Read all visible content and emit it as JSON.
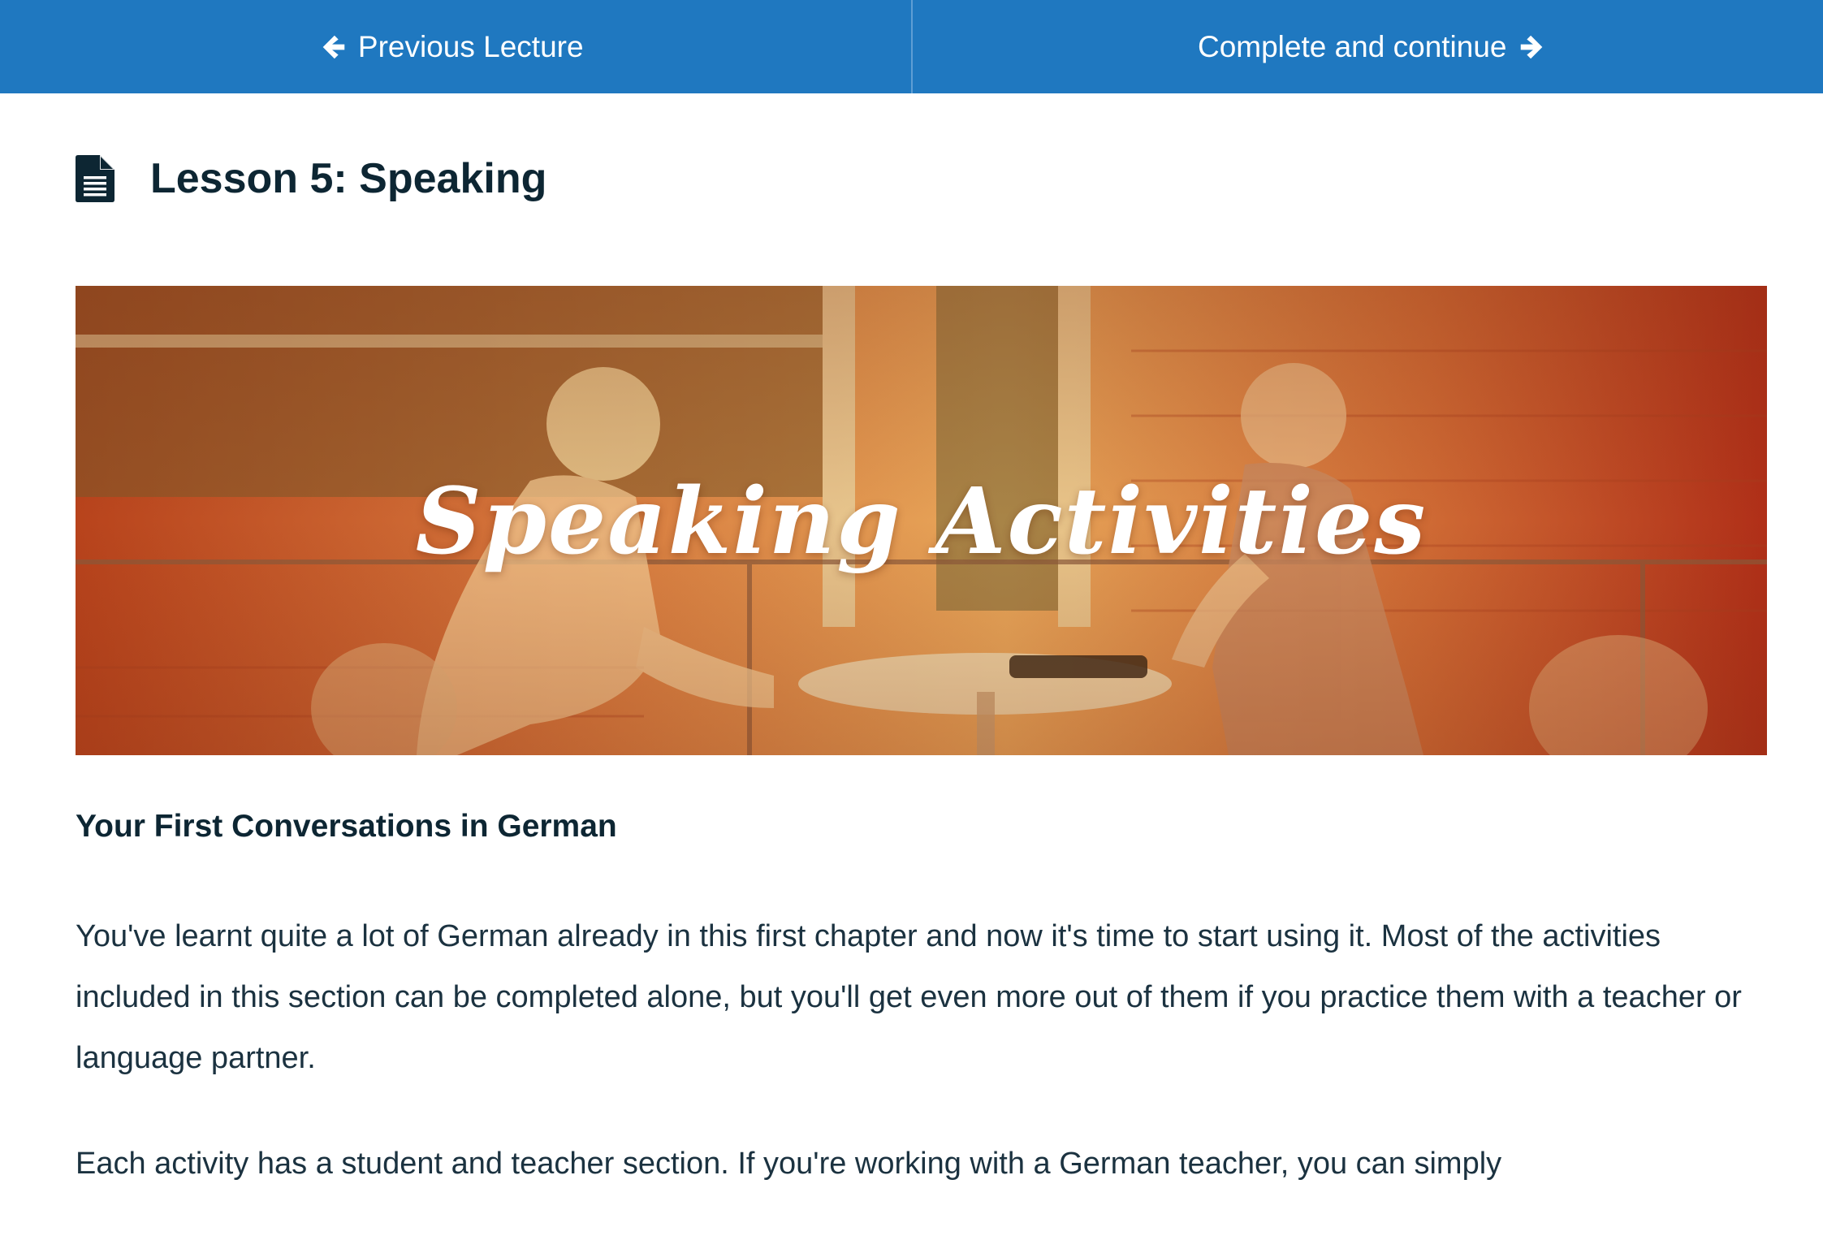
{
  "nav": {
    "previous_label": "Previous Lecture",
    "next_label": "Complete and continue",
    "accent_color": "#1f78c0"
  },
  "lesson": {
    "title": "Lesson 5: Speaking",
    "icon": "document-icon"
  },
  "banner": {
    "title": "Speaking Activities"
  },
  "content": {
    "heading": "Your First Conversations in German",
    "paragraphs": [
      "You've learnt quite a lot of German already in this first chapter and now it's time to start using it. Most of the activities included in this section can be completed alone, but you'll get even more out of them if you practice them with a teacher or language partner.",
      "Each activity has a student and teacher section. If you're working with a German teacher, you can simply"
    ]
  }
}
